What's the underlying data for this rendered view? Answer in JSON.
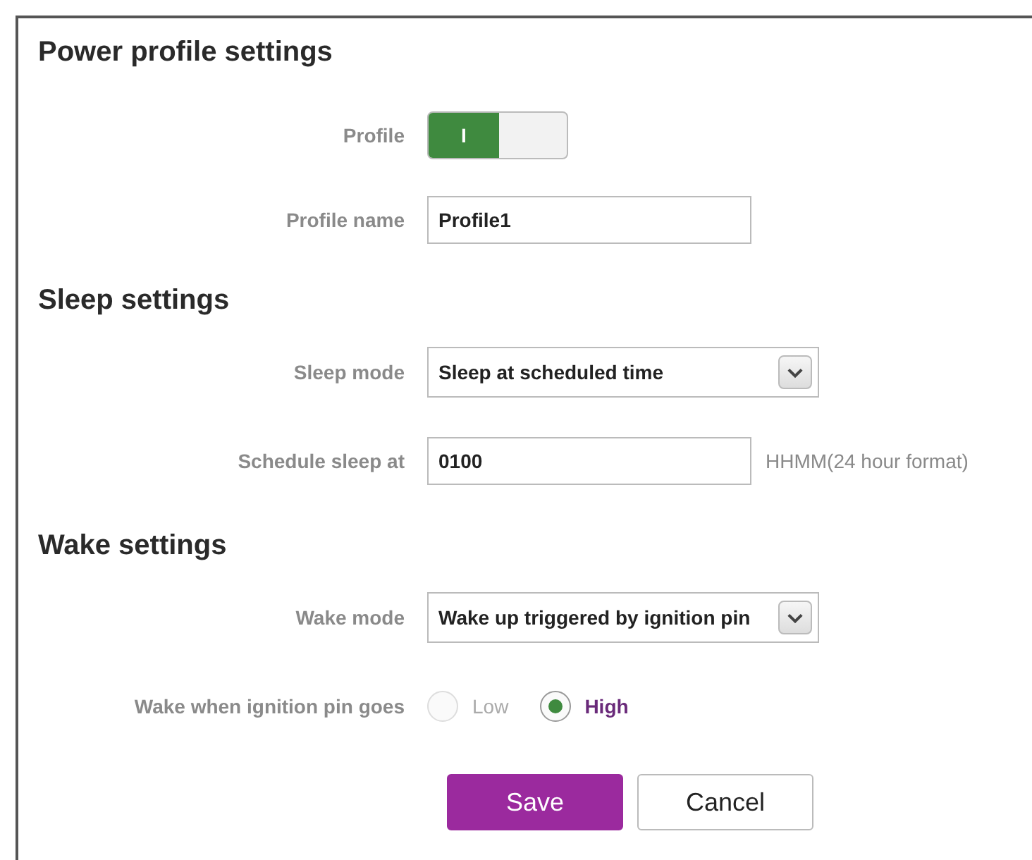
{
  "sections": [
    {
      "title": "Power profile settings",
      "fields": [
        {
          "kind": "toggle",
          "label": "Profile",
          "on": true,
          "on_text": "I"
        },
        {
          "kind": "text",
          "label": "Profile name",
          "value": "Profile1"
        }
      ]
    },
    {
      "title": "Sleep settings",
      "fields": [
        {
          "kind": "select",
          "label": "Sleep mode",
          "value": "Sleep at scheduled time"
        },
        {
          "kind": "text",
          "label": "Schedule sleep at",
          "value": "0100",
          "hint": "HHMM(24 hour format)"
        }
      ]
    },
    {
      "title": "Wake settings",
      "fields": [
        {
          "kind": "select",
          "label": "Wake mode",
          "value": "Wake up triggered by ignition pin"
        },
        {
          "kind": "radio",
          "label": "Wake when ignition pin goes",
          "options": [
            {
              "label": "Low",
              "selected": false
            },
            {
              "label": "High",
              "selected": true
            }
          ]
        }
      ]
    }
  ],
  "buttons": [
    {
      "label": "Save",
      "kind": "primary"
    },
    {
      "label": "Cancel",
      "kind": "secondary"
    }
  ]
}
